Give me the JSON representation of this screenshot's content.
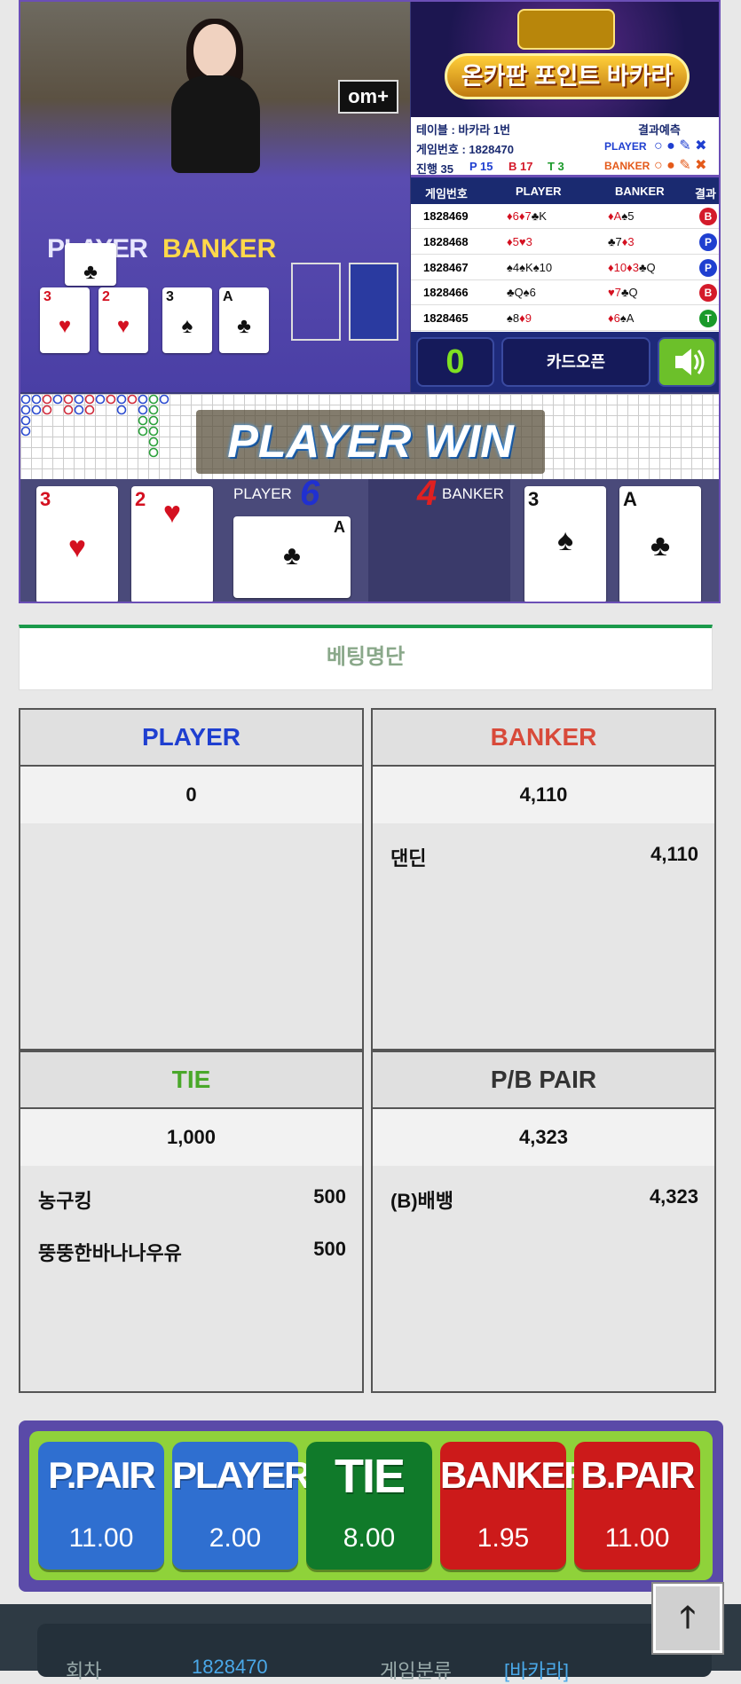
{
  "video": {
    "brand_sign": "om+",
    "table_player_label": "PLAYER",
    "table_banker_label": "BANKER"
  },
  "panel": {
    "banner_title": "온카판 포인트 바카라",
    "table_info": "테이블 : 바카라 1번",
    "predict_label": "결과예측",
    "game_no": "게임번호 : 1828470",
    "progress_label": "진행 35",
    "p_count": "P 15",
    "b_count": "B 17",
    "t_count": "T 3",
    "player_label": "PLAYER",
    "banker_label": "BANKER",
    "counter": "0",
    "card_open": "카드오픈"
  },
  "results": {
    "headers": [
      "게임번호",
      "PLAYER",
      "BANKER",
      "결과"
    ],
    "rows": [
      {
        "no": "1828469",
        "player": "♦6♦7♣K",
        "banker": "♦A♠5",
        "result": "B"
      },
      {
        "no": "1828468",
        "player": "♦5♥3",
        "banker": "♣7♦3",
        "result": "P"
      },
      {
        "no": "1828467",
        "player": "♠4♠K♠10",
        "banker": "♦10♦3♣Q",
        "result": "P"
      },
      {
        "no": "1828466",
        "player": "♣Q♠6",
        "banker": "♥7♣Q",
        "result": "B"
      },
      {
        "no": "1828465",
        "player": "♠8♦9",
        "banker": "♦6♠A",
        "result": "T"
      }
    ]
  },
  "win_banner": "PLAYER WIN",
  "dealt": {
    "player_label": "PLAYER",
    "player_score": "6",
    "banker_label": "BANKER",
    "banker_score": "4",
    "player_cards": [
      {
        "rank": "3",
        "suit": "♥"
      },
      {
        "rank": "2",
        "suit": "♥"
      },
      {
        "rank": "A",
        "suit": "♣"
      }
    ],
    "banker_cards": [
      {
        "rank": "3",
        "suit": "♠"
      },
      {
        "rank": "A",
        "suit": "♣"
      }
    ]
  },
  "section_title": "베팅명단",
  "boxes": {
    "player": {
      "title": "PLAYER",
      "total": "0",
      "items": []
    },
    "banker": {
      "title": "BANKER",
      "total": "4,110",
      "items": [
        {
          "name": "댄딘",
          "value": "4,110"
        }
      ]
    },
    "tie": {
      "title": "TIE",
      "total": "1,000",
      "items": [
        {
          "name": "농구킹",
          "value": "500"
        },
        {
          "name": "뚱뚱한바나나우유",
          "value": "500"
        }
      ]
    },
    "pair": {
      "title": "P/B PAIR",
      "total": "4,323",
      "items": [
        {
          "name": "(B)배뱅",
          "value": "4,323"
        }
      ]
    }
  },
  "bets": [
    {
      "name": "P.PAIR",
      "odds": "11.00",
      "color": "#2f6fd0"
    },
    {
      "name": "PLAYER",
      "odds": "2.00",
      "color": "#2f6fd0"
    },
    {
      "name": "TIE",
      "odds": "8.00",
      "color": "#107a2a"
    },
    {
      "name": "BANKER",
      "odds": "1.95",
      "color": "#cc1a1a"
    },
    {
      "name": "B.PAIR",
      "odds": "11.00",
      "color": "#cc1a1a"
    }
  ],
  "bottom": {
    "round_label": "회차",
    "round_value": "1828470",
    "type_label": "게임분류",
    "type_value": "[바카라]"
  },
  "colors": {
    "player": "#1f3fd0",
    "banker": "#d84a3a",
    "tie": "#4aa82a",
    "accent": "#1a9a4a"
  }
}
